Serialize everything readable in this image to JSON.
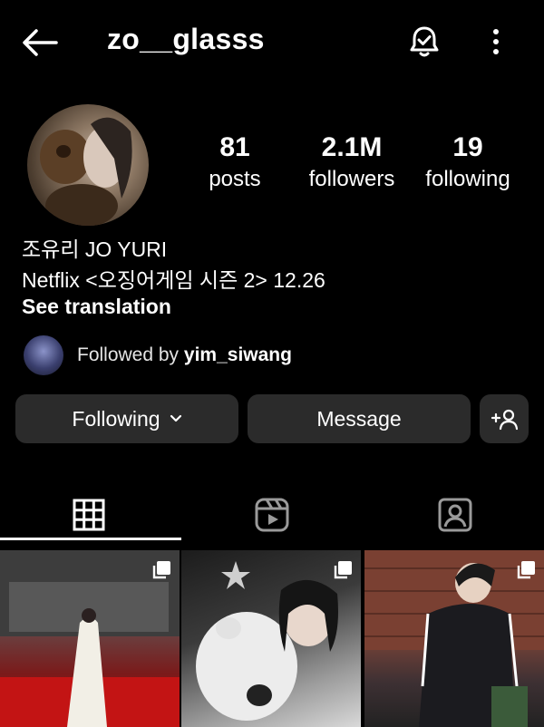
{
  "header": {
    "username": "zo__glasss"
  },
  "profile": {
    "stats": [
      {
        "value": "81",
        "label": "posts"
      },
      {
        "value": "2.1M",
        "label": "followers"
      },
      {
        "value": "19",
        "label": "following"
      }
    ],
    "name": "조유리 JO YURI",
    "bio": "Netflix <오징어게임 시즌 2> 12.26",
    "see_translation": "See translation",
    "followed_by_prefix": "Followed by",
    "followed_by_user": "yim_siwang"
  },
  "actions": {
    "following_label": "Following",
    "message_label": "Message"
  },
  "tabs": [
    {
      "icon": "grid-icon"
    },
    {
      "icon": "reels-icon"
    },
    {
      "icon": "tagged-icon"
    }
  ],
  "posts": [
    {
      "icon": "multi-post-icon"
    },
    {
      "icon": "multi-post-icon"
    },
    {
      "icon": "multi-post-icon"
    }
  ]
}
